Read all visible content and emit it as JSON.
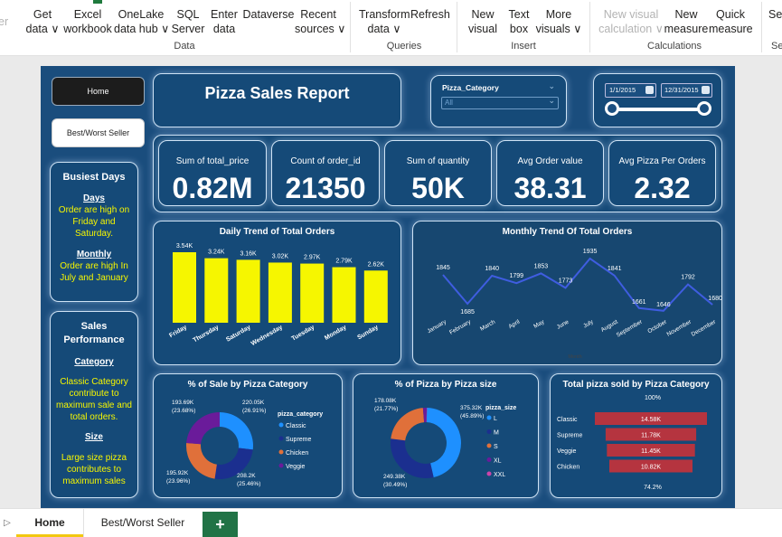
{
  "ribbon": {
    "items": [
      {
        "label1": "Get",
        "label2": "data ∨"
      },
      {
        "label1": "Excel",
        "label2": "workbook"
      },
      {
        "label1": "OneLake",
        "label2": "data hub ∨"
      },
      {
        "label1": "SQL",
        "label2": "Server"
      },
      {
        "label1": "Enter",
        "label2": "data"
      },
      {
        "label1": "Dataverse",
        "label2": ""
      },
      {
        "label1": "Recent",
        "label2": "sources ∨"
      },
      {
        "label1": "Transform",
        "label2": "data ∨"
      },
      {
        "label1": "Refresh",
        "label2": ""
      },
      {
        "label1": "New",
        "label2": "visual"
      },
      {
        "label1": "Text",
        "label2": "box"
      },
      {
        "label1": "More",
        "label2": "visuals ∨"
      },
      {
        "label1": "New visual",
        "label2": "calculation ∨"
      },
      {
        "label1": "New",
        "label2": "measure"
      },
      {
        "label1": "Quick",
        "label2": "measure"
      }
    ],
    "groups": [
      "Data",
      "Queries",
      "Insert",
      "Calculations"
    ],
    "edge_left": "er",
    "edge_right1": "Se",
    "edge_right2": "Se"
  },
  "nav": {
    "home": "Home",
    "best_worst": "Best/Worst Seller"
  },
  "header": {
    "title": "Pizza Sales Report"
  },
  "slicer": {
    "label": "Pizza_Category",
    "value": "All"
  },
  "date_range": {
    "start": "1/1/2015",
    "end": "12/31/2015"
  },
  "kpis": [
    {
      "label": "Sum of total_price",
      "value": "0.82M"
    },
    {
      "label": "Count of order_id",
      "value": "21350"
    },
    {
      "label": "Sum of quantity",
      "value": "50K"
    },
    {
      "label": "Avg Order value",
      "value": "38.31"
    },
    {
      "label": "Avg Pizza Per Orders",
      "value": "2.32"
    }
  ],
  "busiest": {
    "title": "Busiest Days",
    "days_head": "Days",
    "days_text": [
      "Order are high on",
      "Friday and",
      "Saturday."
    ],
    "monthly_head": "Monthly",
    "monthly_text": [
      "Order are high In",
      "July and January"
    ]
  },
  "performance": {
    "title1": "Sales",
    "title2": "Performance",
    "cat_head": "Category",
    "cat_text": [
      "Classic Category",
      "contribute to",
      "maximum  sale and",
      "total orders."
    ],
    "size_head": "Size",
    "size_text": [
      "Large size pizza",
      "contributes to",
      "maximum sales"
    ]
  },
  "colors": {
    "bar": "#f6f600",
    "line": "#3f5de0",
    "funnel": "#b5343f",
    "donut": [
      "#1e90ff",
      "#1b2f8f",
      "#e0703a",
      "#6a1b9a",
      "#cc44aa"
    ]
  },
  "chart_data": [
    {
      "type": "bar",
      "title": "Daily Trend of Total Orders",
      "categories": [
        "Friday",
        "Thursday",
        "Saturday",
        "Wednesday",
        "Tuesday",
        "Monday",
        "Sunday"
      ],
      "values": [
        3540,
        3240,
        3160,
        3020,
        2970,
        2790,
        2620
      ],
      "labels": [
        "3.54K",
        "3.24K",
        "3.16K",
        "3.02K",
        "2.97K",
        "2.79K",
        "2.62K"
      ]
    },
    {
      "type": "line",
      "title": "Monthly Trend Of Total Orders",
      "xlabel": "Month",
      "categories": [
        "January",
        "February",
        "March",
        "April",
        "May",
        "June",
        "July",
        "August",
        "September",
        "October",
        "November",
        "December"
      ],
      "values": [
        1845,
        1685,
        1840,
        1799,
        1853,
        1773,
        1935,
        1841,
        1661,
        1646,
        1792,
        1680
      ],
      "labels": [
        "1845",
        "1685",
        "1840",
        "1799",
        "1853",
        "1773",
        "1935",
        "1841",
        "1661",
        "1646",
        "1792",
        "1680"
      ]
    },
    {
      "type": "pie",
      "title": "% of Sale by Pizza Category",
      "legend_title": "pizza_category",
      "categories": [
        "Classic",
        "Supreme",
        "Chicken",
        "Veggie"
      ],
      "values": [
        220.05,
        208.2,
        195.92,
        193.69
      ],
      "labels": [
        "220.05K\n(26.91%)",
        "208.2K\n(25.46%)",
        "195.92K\n(23.96%)",
        "193.69K\n(23.68%)"
      ]
    },
    {
      "type": "pie",
      "title": "% of Pizza by Pizza size",
      "legend_title": "pizza_size",
      "categories": [
        "L",
        "M",
        "S",
        "XL",
        "XXL"
      ],
      "values": [
        375.32,
        249.38,
        178.08,
        14.08,
        1.01
      ],
      "labels": [
        "375.32K\n(45.89%)",
        "249.38K\n(30.49%)",
        "178.08K\n(21.77%)",
        "",
        ""
      ]
    },
    {
      "type": "bar",
      "title": "Total pizza sold by Pizza Category",
      "top_label": "100%",
      "bottom_label": "74.2%",
      "categories": [
        "Classic",
        "Supreme",
        "Veggie",
        "Chicken"
      ],
      "values": [
        14580,
        11780,
        11450,
        10820
      ],
      "labels": [
        "14.58K",
        "11.78K",
        "11.45K",
        "10.82K"
      ]
    }
  ],
  "tabs": {
    "home": "Home",
    "best_worst": "Best/Worst Seller",
    "add": "+"
  }
}
